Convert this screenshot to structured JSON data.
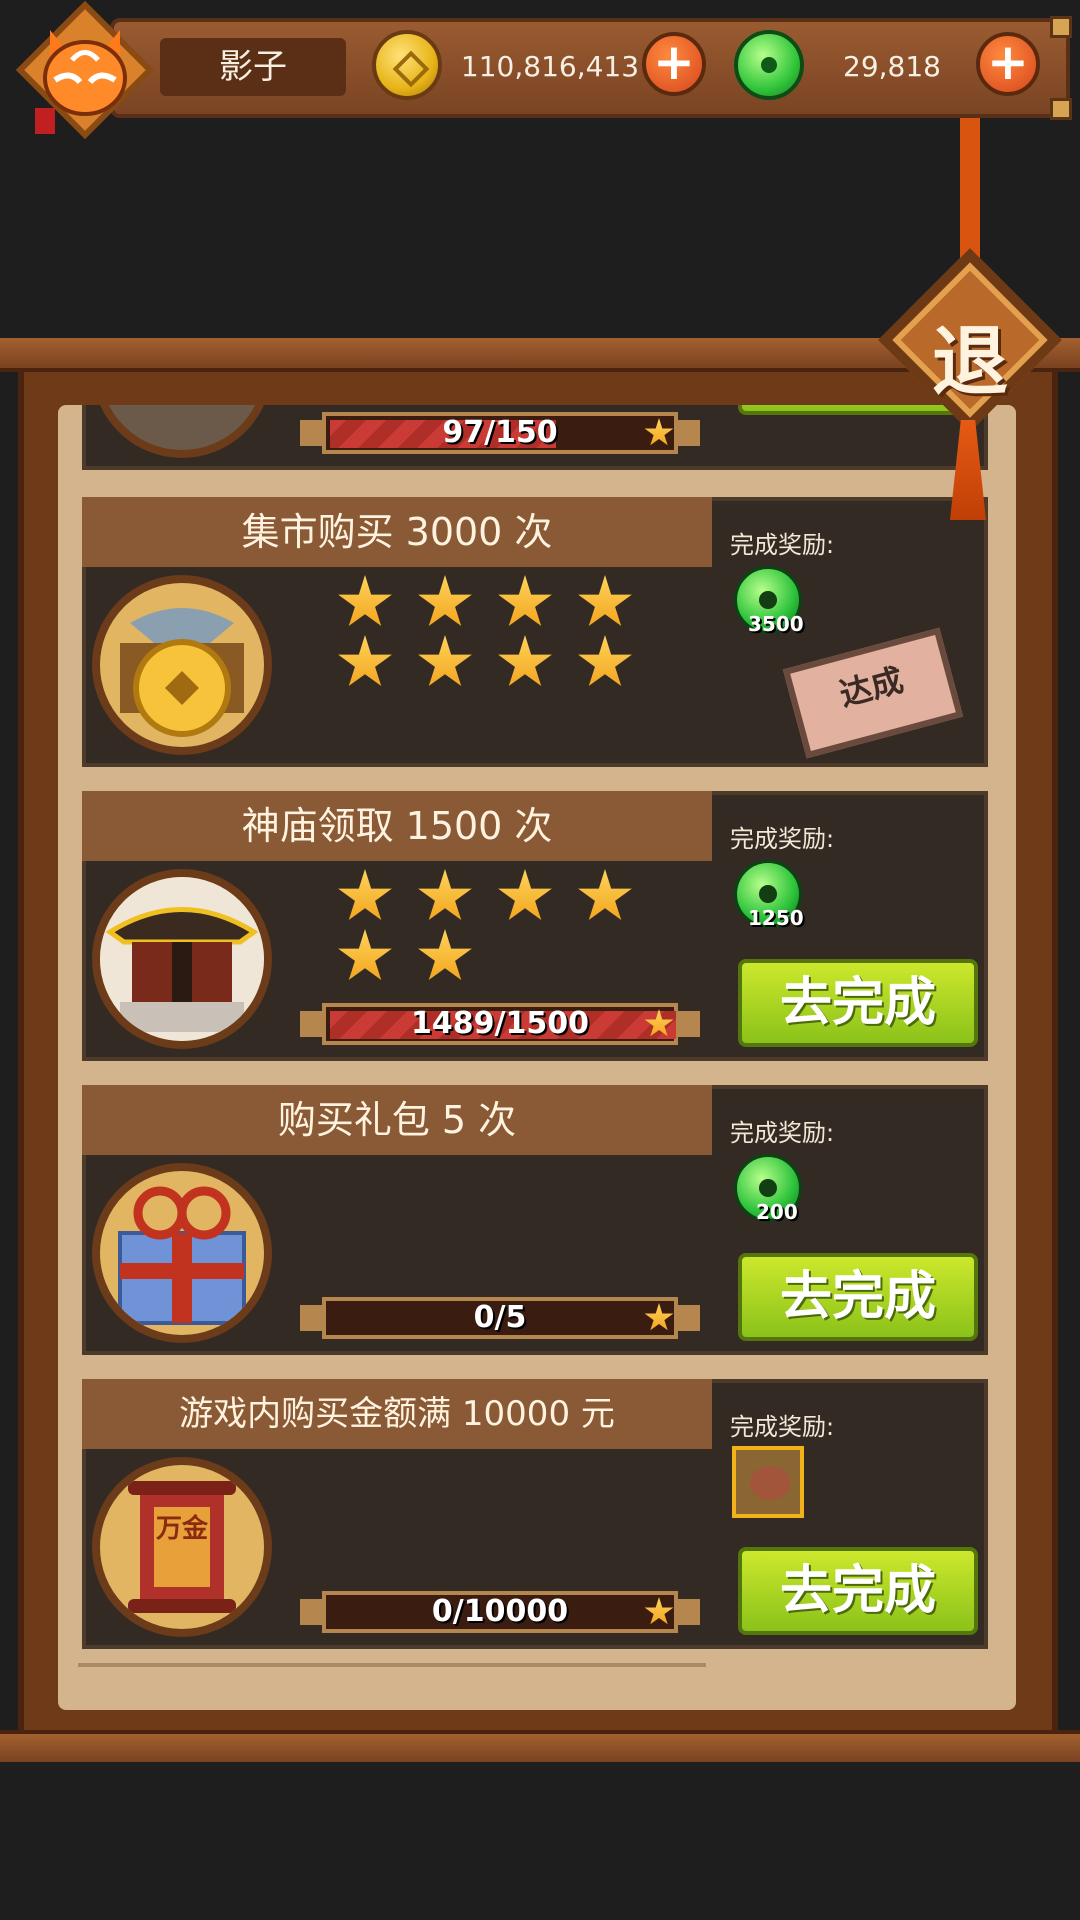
{
  "header": {
    "player_name": "影子",
    "gold": "110,816,413",
    "jade": "29,818",
    "exit_label": "退"
  },
  "tasks": [
    {
      "title": "",
      "progress_text": "97/150",
      "progress_fraction": 0.65
    },
    {
      "title": "集市购买 3000 次",
      "reward_label": "完成奖励:",
      "reward_count": "3500",
      "stars": 8,
      "stamp_label": "达成"
    },
    {
      "title": "神庙领取 1500 次",
      "reward_label": "完成奖励:",
      "reward_count": "1250",
      "stars": 6,
      "progress_text": "1489/1500",
      "progress_fraction": 0.993,
      "button_label": "去完成"
    },
    {
      "title": "购买礼包 5 次",
      "reward_label": "完成奖励:",
      "reward_count": "200",
      "stars": 0,
      "progress_text": "0/5",
      "progress_fraction": 0,
      "button_label": "去完成"
    },
    {
      "title": "游戏内购买金额满 10000 元",
      "reward_label": "完成奖励:",
      "stars": 0,
      "progress_text": "0/10000",
      "progress_fraction": 0,
      "button_label": "去完成",
      "scroll_text": "万金"
    }
  ],
  "colors": {
    "background": "#1e1e1e",
    "wood": "#7a4423",
    "parchment": "#d3b48c",
    "card": "#332a23",
    "title_bar": "#8a5a36",
    "go_button": "#a9d420",
    "progress_fill": "#c93b34"
  }
}
